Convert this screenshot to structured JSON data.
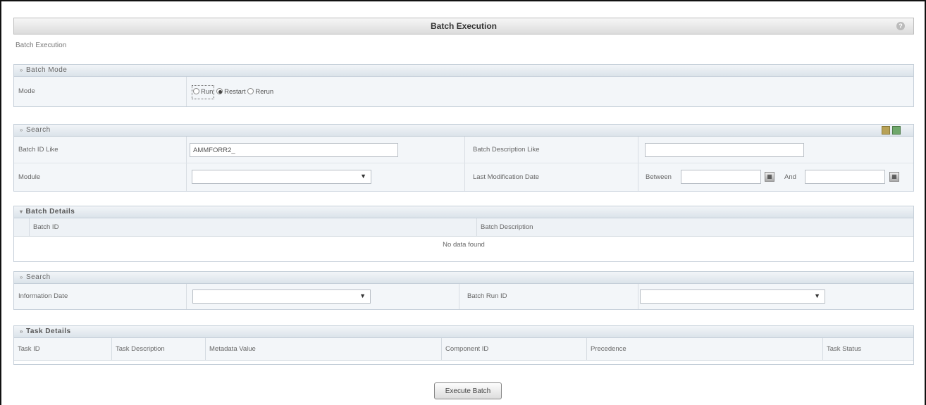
{
  "title": "Batch Execution",
  "breadcrumb": "Batch Execution",
  "batch_mode": {
    "header": "Batch Mode",
    "mode_label": "Mode",
    "options": [
      {
        "label": "Run",
        "checked": false
      },
      {
        "label": "Restart",
        "checked": true
      },
      {
        "label": "Rerun",
        "checked": false
      }
    ]
  },
  "search1": {
    "header": "Search",
    "batch_id_label": "Batch ID Like",
    "batch_id_value": "AMMFORR2_",
    "batch_desc_label": "Batch Description Like",
    "batch_desc_value": "",
    "module_label": "Module",
    "module_value": "",
    "last_mod_label": "Last Modification Date",
    "between_label": "Between",
    "and_label": "And",
    "between_value": "",
    "and_value": ""
  },
  "batch_details": {
    "header": "Batch Details",
    "columns": [
      "Batch ID",
      "Batch Description"
    ],
    "empty_text": "No data found"
  },
  "search2": {
    "header": "Search",
    "info_date_label": "Information Date",
    "info_date_value": "",
    "batch_run_label": "Batch Run ID",
    "batch_run_value": ""
  },
  "task_details": {
    "header": "Task Details",
    "columns": [
      "Task ID",
      "Task Description",
      "Metadata Value",
      "Component ID",
      "Precedence",
      "Task Status"
    ]
  },
  "execute_button": "Execute Batch",
  "icons": {
    "help": "help-icon",
    "calendar": "calendar-icon",
    "search_go": "search-go-icon",
    "clear": "clear-icon"
  }
}
